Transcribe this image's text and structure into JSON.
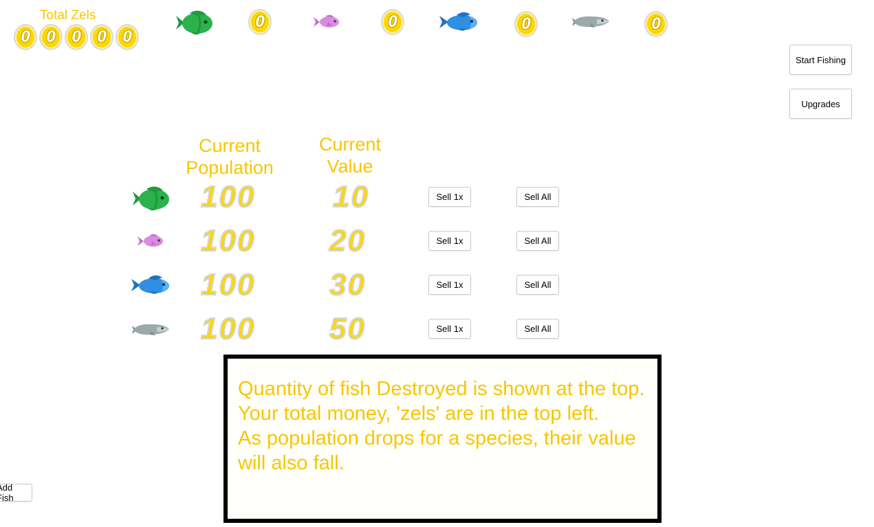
{
  "total": {
    "label": "Total Zels",
    "digits": [
      "0",
      "0",
      "0",
      "0",
      "0"
    ]
  },
  "destroyed": [
    {
      "fish": "green-fish-icon",
      "count": "0"
    },
    {
      "fish": "pink-fish-icon",
      "count": "0"
    },
    {
      "fish": "blue-fish-icon",
      "count": "0"
    },
    {
      "fish": "grey-fish-icon",
      "count": "0"
    }
  ],
  "buttons": {
    "start_fishing": "Start Fishing",
    "upgrades": "Upgrades",
    "add_fish": "Add Fish"
  },
  "table": {
    "col_population": "Current\nPopulation",
    "col_value": "Current\nValue",
    "rows": [
      {
        "fish": "green-fish-icon",
        "population": "100",
        "value": "10",
        "sell_one": "Sell 1x",
        "sell_all": "Sell All"
      },
      {
        "fish": "pink-fish-icon",
        "population": "100",
        "value": "20",
        "sell_one": "Sell 1x",
        "sell_all": "Sell All"
      },
      {
        "fish": "blue-fish-icon",
        "population": "100",
        "value": "30",
        "sell_one": "Sell 1x",
        "sell_all": "Sell All"
      },
      {
        "fish": "grey-fish-icon",
        "population": "100",
        "value": "50",
        "sell_one": "Sell 1x",
        "sell_all": "Sell All"
      }
    ]
  },
  "info": {
    "line1": "Quantity of fish Destroyed is shown at the top.",
    "line2": "Your total money, 'zels' are in the top left.",
    "line3": "As population drops for a species, their value will also fall."
  },
  "colors": {
    "accent": "#f7c600",
    "coin": "#fcd700",
    "green_fish": "#2bb24c",
    "pink_fish": "#d98be0",
    "blue_fish": "#2f8fe0",
    "grey_fish": "#9aa9a9"
  }
}
